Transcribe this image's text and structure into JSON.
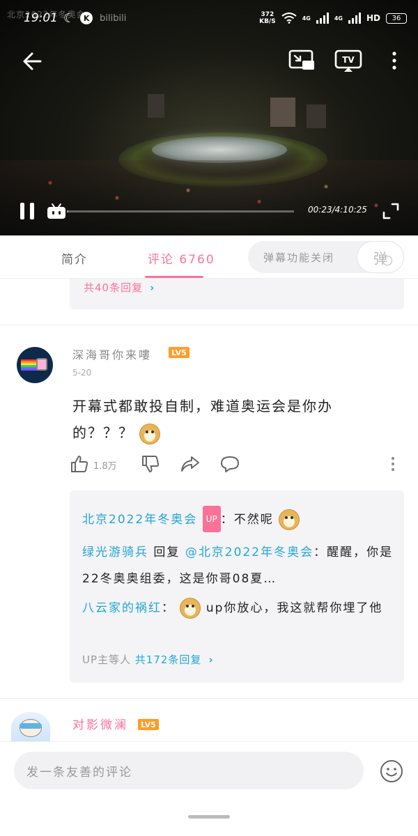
{
  "status_bar": {
    "time": "19:01",
    "watermark": "北京2022年冬奥会",
    "bili_logo": "bilibili",
    "k_badge": "K",
    "speed_value": "372",
    "speed_unit": "KB/S",
    "net1": "4G",
    "net2": "4G",
    "hd": "HD",
    "battery": "36"
  },
  "video": {
    "time_readout": "00:23/4:10:25",
    "progress": 0.0015
  },
  "tabs": {
    "intro": "简介",
    "comments": "评论 6760",
    "danmaku_toggle": "弹幕功能关闭",
    "danmaku_button": "弹"
  },
  "prev_comment": {
    "replies_link": "共40条回复"
  },
  "comment": {
    "username": "深海哥你来嘍",
    "level": "LV5",
    "date": "5-20",
    "text": "开幕式都敢投自制，难道奥运会是你办的？？？",
    "likes": "1.8万"
  },
  "replies": [
    {
      "author": "北京2022年冬奥会",
      "badge": "UP",
      "sep": "：",
      "text": "不然呢"
    },
    {
      "author": "绿光游骑兵",
      "action": " 回复 ",
      "target": "@北京2022年冬奥会",
      "sep": "：",
      "text": "醒醒，你是22冬奥奥组委，这是你哥08夏…"
    },
    {
      "author": "八云家的祸红",
      "sep": "：",
      "text": "up你放心，我这就帮你埋了他"
    }
  ],
  "reply_summary": {
    "prefix": "UP主等人 ",
    "count_link": "共172条回复"
  },
  "next_comment": {
    "username": "对影微澜",
    "level": "LV5"
  },
  "input": {
    "placeholder": "发一条友善的评论"
  },
  "colors": {
    "accent": "#fb7299",
    "link": "#23a6d5",
    "level_badge": "#ff9c2b"
  }
}
